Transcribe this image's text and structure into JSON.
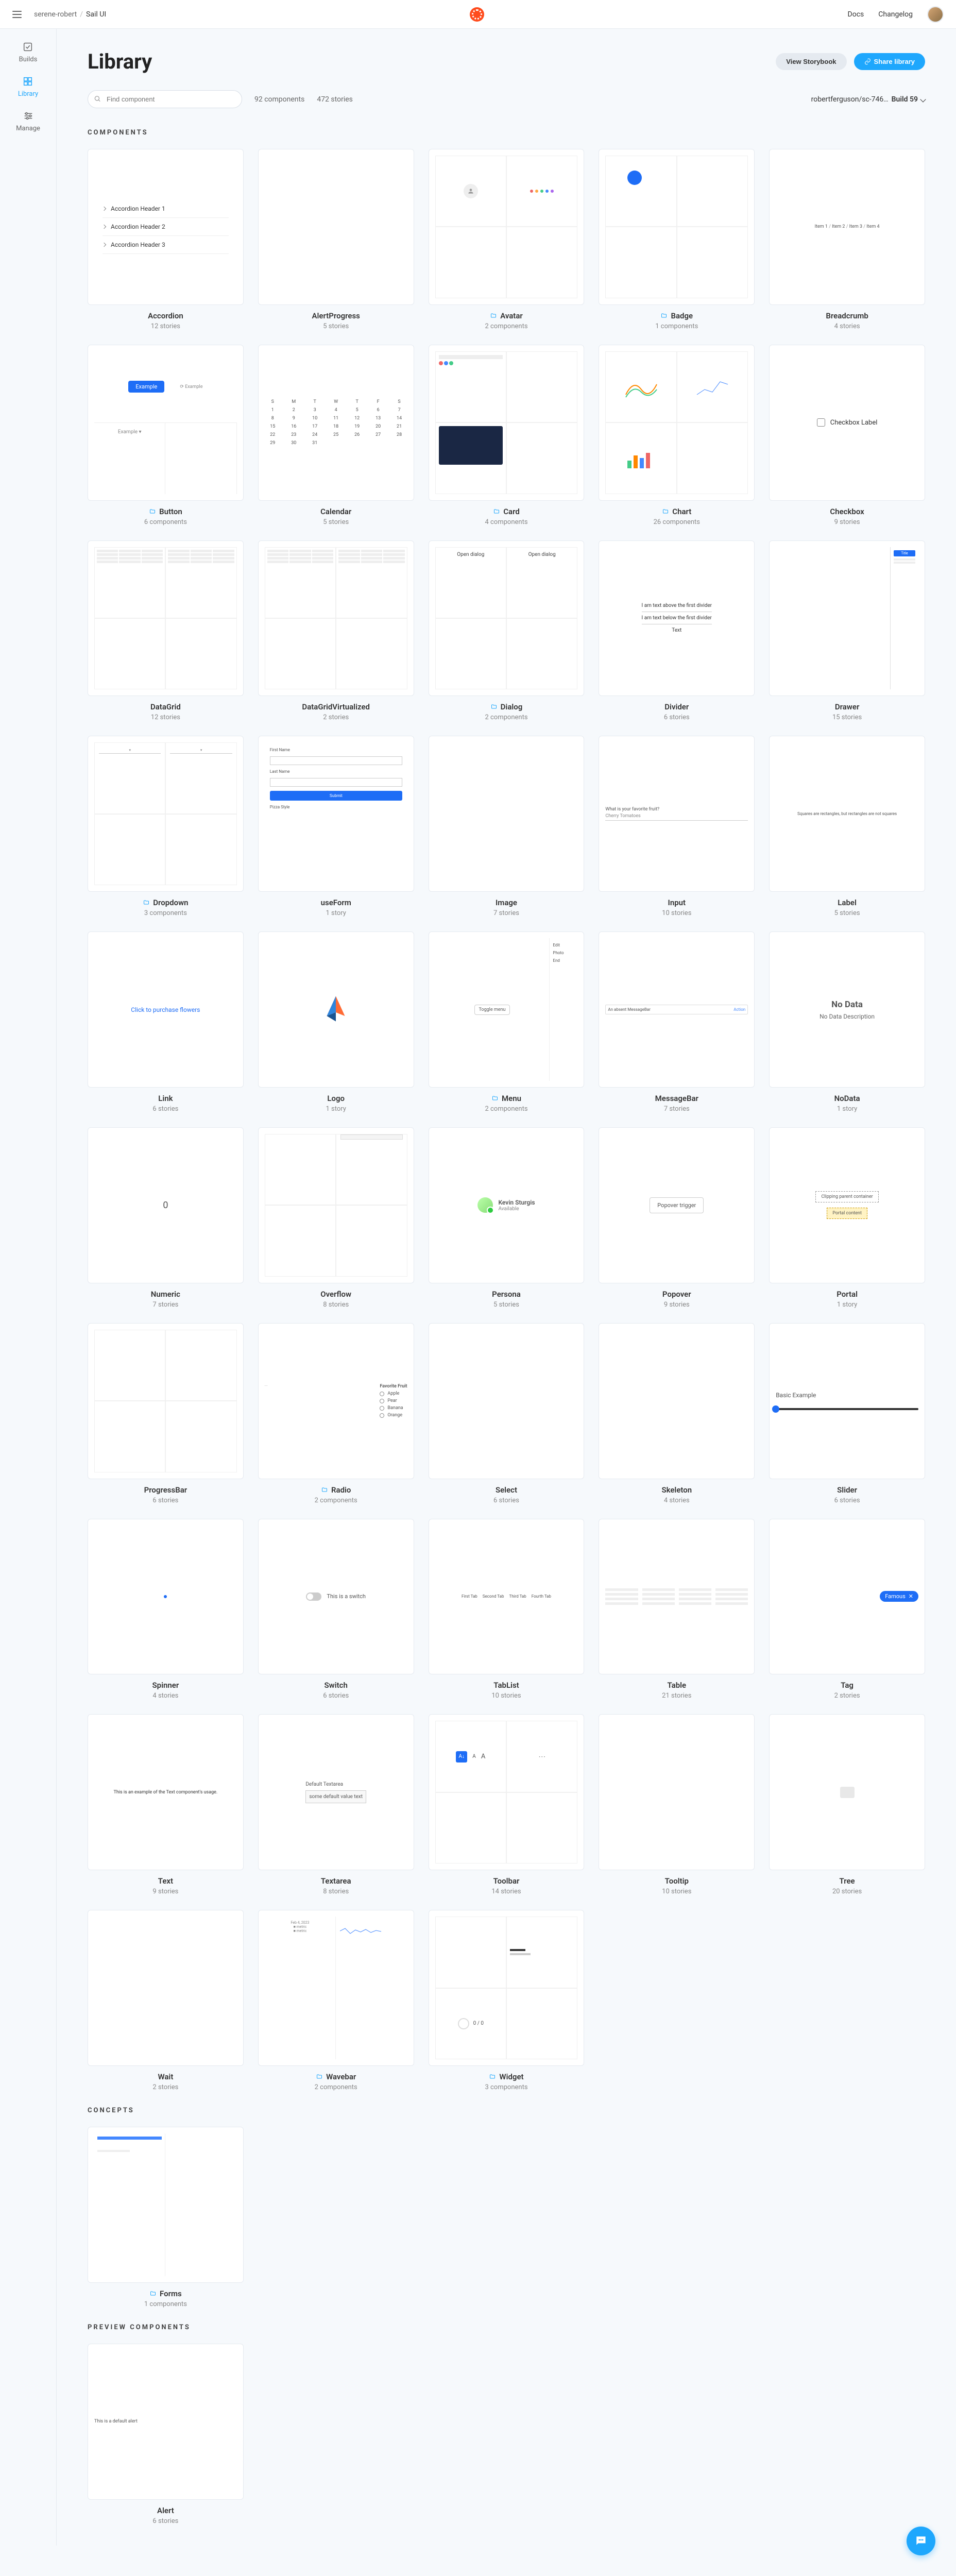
{
  "top": {
    "org": "serene-robert",
    "project": "Sail UI",
    "docs": "Docs",
    "changelog": "Changelog"
  },
  "sidebar": {
    "builds": "Builds",
    "library": "Library",
    "manage": "Manage"
  },
  "page": {
    "title": "Library",
    "viewStorybook": "View Storybook",
    "shareLibrary": "Share library",
    "searchPlaceholder": "Find component",
    "componentsCount": "92 components",
    "storiesCount": "472 stories",
    "branch": "robertferguson/sc-746…",
    "build": "Build 59"
  },
  "sections": {
    "components": "COMPONENTS",
    "concepts": "CONCEPTS",
    "preview": "PREVIEW COMPONENTS"
  },
  "previews": {
    "accordionH1": "Accordion Header 1",
    "accordionH2": "Accordion Header 2",
    "accordionH3": "Accordion Header 3",
    "breadcrumb": "Item 1 / Item 2 / Item 3 / Item 4",
    "buttonExample": "Example",
    "checkboxLabel": "Checkbox Label",
    "dialogOpen": "Open dialog",
    "dividerAbove": "I am text above the first divider",
    "dividerBelow": "I am text below the first divider",
    "dividerText": "Text",
    "drawerTitle": "Title",
    "formFirst": "First Name",
    "formLast": "Last Name",
    "formPizza": "Pizza Style",
    "formSubmit": "Submit",
    "inputLabel": "What is your favorite fruit?",
    "inputValue": "Cherry Tomatoes",
    "labelText": "Squares are rectangles, but rectangles are not squares",
    "link": "Click to purchase flowers",
    "menuToggle": "Toggle menu",
    "menuEdit": "Edit",
    "menuPhoto": "Photo",
    "menuEnd": "End",
    "msgbar": "An absent MessageBar",
    "nodataTitle": "No Data",
    "nodataDesc": "No Data Description",
    "numeric": "0",
    "personaName": "Kevin Sturgis",
    "personaStatus": "Available",
    "popoverTrigger": "Popover trigger",
    "portalParent": "Clipping parent container",
    "portalContent": "Portal content",
    "radioTitle": "Favorite Fruit",
    "radioOpts": [
      "Apple",
      "Pear",
      "Banana",
      "Orange"
    ],
    "sliderTitle": "Basic Example",
    "switchLabel": "This is a switch",
    "tabs": [
      "First Tab",
      "Second Tab",
      "Third Tab",
      "Fourth Tab"
    ],
    "tag": "Famous",
    "text": "This is an example of the Text component's usage.",
    "textareaLabel": "Default Textarea",
    "textareaValue": "some default value text",
    "widgetCount": "0 / 0",
    "alertText": "This is a default alert"
  },
  "components": [
    {
      "name": "Accordion",
      "sub": "12 stories",
      "folder": false,
      "prev": "accordion"
    },
    {
      "name": "AlertProgress",
      "sub": "5 stories",
      "folder": false,
      "prev": "blank"
    },
    {
      "name": "Avatar",
      "sub": "2 components",
      "folder": true,
      "prev": "avatar"
    },
    {
      "name": "Badge",
      "sub": "1 components",
      "folder": true,
      "prev": "badge"
    },
    {
      "name": "Breadcrumb",
      "sub": "4 stories",
      "folder": false,
      "prev": "breadcrumb"
    },
    {
      "name": "Button",
      "sub": "6 components",
      "folder": true,
      "prev": "button"
    },
    {
      "name": "Calendar",
      "sub": "5 stories",
      "folder": false,
      "prev": "calendar"
    },
    {
      "name": "Card",
      "sub": "4 components",
      "folder": true,
      "prev": "card"
    },
    {
      "name": "Chart",
      "sub": "26 components",
      "folder": true,
      "prev": "chart"
    },
    {
      "name": "Checkbox",
      "sub": "9 stories",
      "folder": false,
      "prev": "checkbox"
    },
    {
      "name": "DataGrid",
      "sub": "12 stories",
      "folder": false,
      "prev": "datagrid"
    },
    {
      "name": "DataGridVirtualized",
      "sub": "2 stories",
      "folder": false,
      "prev": "datagrid"
    },
    {
      "name": "Dialog",
      "sub": "2 components",
      "folder": true,
      "prev": "dialog"
    },
    {
      "name": "Divider",
      "sub": "6 stories",
      "folder": false,
      "prev": "divider"
    },
    {
      "name": "Drawer",
      "sub": "15 stories",
      "folder": false,
      "prev": "drawer"
    },
    {
      "name": "Dropdown",
      "sub": "3 components",
      "folder": true,
      "prev": "dropdown"
    },
    {
      "name": "useForm",
      "sub": "1 story",
      "folder": false,
      "prev": "form"
    },
    {
      "name": "Image",
      "sub": "7 stories",
      "folder": false,
      "prev": "blank"
    },
    {
      "name": "Input",
      "sub": "10 stories",
      "folder": false,
      "prev": "input"
    },
    {
      "name": "Label",
      "sub": "5 stories",
      "folder": false,
      "prev": "label"
    },
    {
      "name": "Link",
      "sub": "6 stories",
      "folder": false,
      "prev": "link"
    },
    {
      "name": "Logo",
      "sub": "1 story",
      "folder": false,
      "prev": "logo"
    },
    {
      "name": "Menu",
      "sub": "2 components",
      "folder": true,
      "prev": "menu"
    },
    {
      "name": "MessageBar",
      "sub": "7 stories",
      "folder": false,
      "prev": "msgbar"
    },
    {
      "name": "NoData",
      "sub": "1 story",
      "folder": false,
      "prev": "nodata"
    },
    {
      "name": "Numeric",
      "sub": "7 stories",
      "folder": false,
      "prev": "numeric"
    },
    {
      "name": "Overflow",
      "sub": "8 stories",
      "folder": false,
      "prev": "overflow"
    },
    {
      "name": "Persona",
      "sub": "5 stories",
      "folder": false,
      "prev": "persona"
    },
    {
      "name": "Popover",
      "sub": "9 stories",
      "folder": false,
      "prev": "popover"
    },
    {
      "name": "Portal",
      "sub": "1 story",
      "folder": false,
      "prev": "portal"
    },
    {
      "name": "ProgressBar",
      "sub": "6 stories",
      "folder": false,
      "prev": "progress"
    },
    {
      "name": "Radio",
      "sub": "2 components",
      "folder": true,
      "prev": "radio"
    },
    {
      "name": "Select",
      "sub": "6 stories",
      "folder": false,
      "prev": "blank"
    },
    {
      "name": "Skeleton",
      "sub": "4 stories",
      "folder": false,
      "prev": "blank"
    },
    {
      "name": "Slider",
      "sub": "6 stories",
      "folder": false,
      "prev": "slider"
    },
    {
      "name": "Spinner",
      "sub": "4 stories",
      "folder": false,
      "prev": "spinner"
    },
    {
      "name": "Switch",
      "sub": "6 stories",
      "folder": false,
      "prev": "switch"
    },
    {
      "name": "TabList",
      "sub": "10 stories",
      "folder": false,
      "prev": "tablist"
    },
    {
      "name": "Table",
      "sub": "21 stories",
      "folder": false,
      "prev": "table"
    },
    {
      "name": "Tag",
      "sub": "2 stories",
      "folder": false,
      "prev": "tag"
    },
    {
      "name": "Text",
      "sub": "9 stories",
      "folder": false,
      "prev": "text"
    },
    {
      "name": "Textarea",
      "sub": "8 stories",
      "folder": false,
      "prev": "textarea"
    },
    {
      "name": "Toolbar",
      "sub": "14 stories",
      "folder": false,
      "prev": "toolbar"
    },
    {
      "name": "Tooltip",
      "sub": "10 stories",
      "folder": false,
      "prev": "blank"
    },
    {
      "name": "Tree",
      "sub": "20 stories",
      "folder": false,
      "prev": "tree"
    },
    {
      "name": "Wait",
      "sub": "2 stories",
      "folder": false,
      "prev": "blank"
    },
    {
      "name": "Wavebar",
      "sub": "2 components",
      "folder": true,
      "prev": "wavebar"
    },
    {
      "name": "Widget",
      "sub": "3 components",
      "folder": true,
      "prev": "widget"
    }
  ],
  "concepts": [
    {
      "name": "Forms",
      "sub": "1 components",
      "folder": true,
      "prev": "forms"
    }
  ],
  "previewComponents": [
    {
      "name": "Alert",
      "sub": "6 stories",
      "folder": false,
      "prev": "alert"
    }
  ]
}
